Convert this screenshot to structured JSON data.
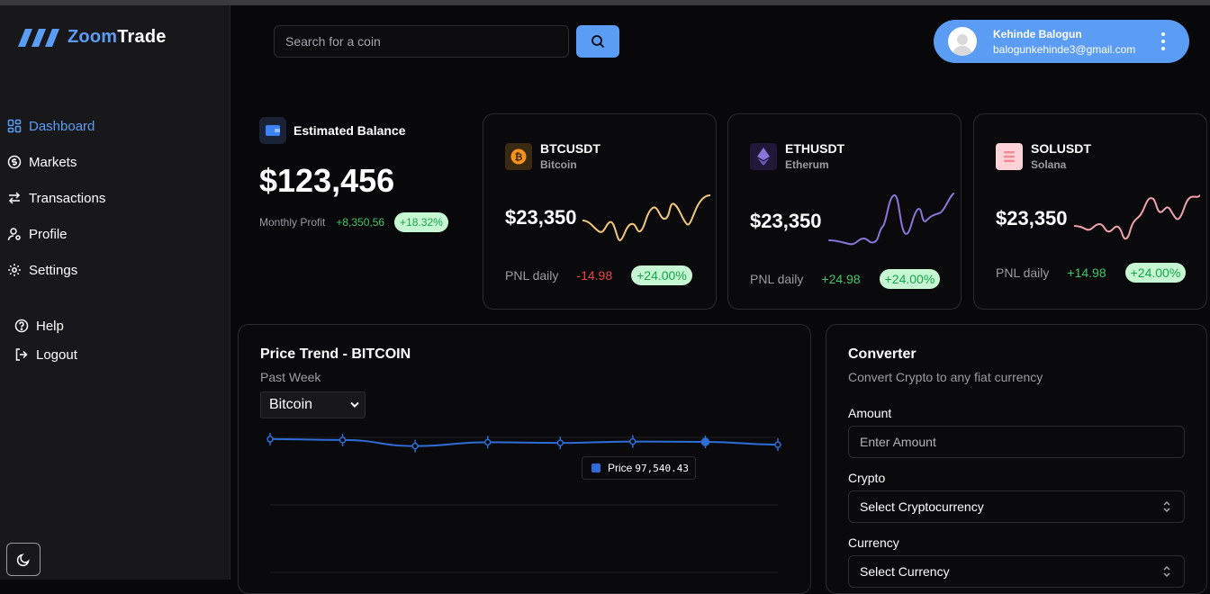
{
  "brand": {
    "part1": "Zoom",
    "part2": "Trade"
  },
  "search": {
    "placeholder": "Search for a coin"
  },
  "user": {
    "name": "Kehinde Balogun",
    "email": "balogunkehinde3@gmail.com"
  },
  "sidebar": {
    "items": [
      {
        "label": "Dashboard",
        "icon": "dashboard-icon",
        "active": true
      },
      {
        "label": "Markets",
        "icon": "dollar-circle-icon",
        "active": false
      },
      {
        "label": "Transactions",
        "icon": "arrows-icon",
        "active": false
      },
      {
        "label": "Profile",
        "icon": "user-icon",
        "active": false
      },
      {
        "label": "Settings",
        "icon": "gear-icon",
        "active": false
      }
    ],
    "bottom": [
      {
        "label": "Help",
        "icon": "help-icon"
      },
      {
        "label": "Logout",
        "icon": "logout-icon"
      }
    ]
  },
  "balance": {
    "title": "Estimated Balance",
    "amount": "$123,456",
    "profit_label": "Monthly Profit",
    "profit_value": "+8,350,56",
    "profit_pct": "+18.32%"
  },
  "coins": [
    {
      "symbol": "BTCUSDT",
      "name": "Bitcoin",
      "price": "$23,350",
      "pnl_label": "PNL daily",
      "pnl_value": "-14.98",
      "pnl_pct": "+24.00%",
      "color": "#f2c880",
      "icon": "bitcoin-icon"
    },
    {
      "symbol": "ETHUSDT",
      "name": "Etherum",
      "price": "$23,350",
      "pnl_label": "PNL daily",
      "pnl_value": "+24.98",
      "pnl_pct": "+24.00%",
      "color": "#8a75d9",
      "icon": "ethereum-icon"
    },
    {
      "symbol": "SOLUSDT",
      "name": "Solana",
      "price": "$23,350",
      "pnl_label": "PNL daily",
      "pnl_value": "+14.98",
      "pnl_pct": "+24.00%",
      "color": "#f0a3ad",
      "icon": "solana-icon"
    }
  ],
  "trend": {
    "title": "Price Trend - BITCOIN",
    "subtitle": "Past Week",
    "selected": "Bitcoin",
    "tooltip_label": "Price",
    "tooltip_value": "97,540.43"
  },
  "chart_data": {
    "type": "line",
    "series": [
      {
        "name": "Price",
        "values": [
          97700,
          97650,
          97300,
          97520,
          97480,
          97560,
          97540,
          97380
        ]
      }
    ],
    "color": "#2e6dd8",
    "grid": true,
    "legend": "none"
  },
  "converter": {
    "title": "Converter",
    "subtitle": "Convert Crypto to any fiat currency",
    "amount_label": "Amount",
    "amount_placeholder": "Enter Amount",
    "crypto_label": "Crypto",
    "crypto_value": "Select Cryptocurrency",
    "currency_label": "Currency",
    "currency_value": "Select Currency"
  },
  "colors": {
    "accent": "#5b9cf5",
    "positive": "#3ec96a",
    "negative": "#ef4444"
  }
}
